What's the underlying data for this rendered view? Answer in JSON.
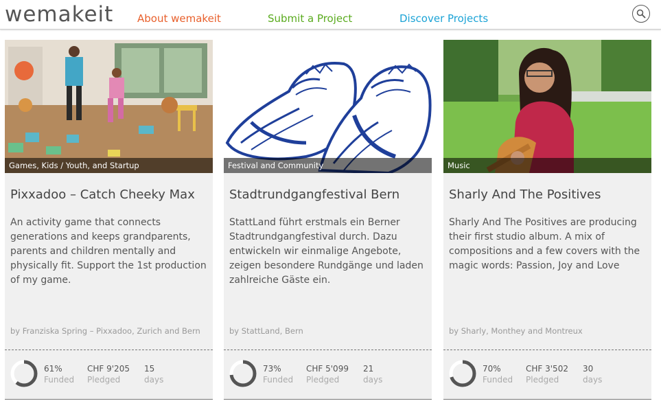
{
  "header": {
    "logo": "wemakeit",
    "nav": {
      "about": "About wemakeit",
      "submit": "Submit a Project",
      "discover": "Discover Projects"
    },
    "search_icon": "search-icon",
    "colors": {
      "about": "#e8602c",
      "submit": "#5aab1e",
      "discover": "#1ba3d6"
    }
  },
  "cards": [
    {
      "category": "Games, Kids / Youth, and Startup",
      "title": "Pixxadoo – Catch Cheeky Max",
      "description": "An activity game that connects generations and keeps grandparents, parents and children mentally and physically fit. Support the 1st production of my game.",
      "author": "by Franziska Spring – Pixxadoo, Zurich and Bern",
      "funded_value": "61%",
      "funded_label": "Funded",
      "funded_fraction": 0.61,
      "pledged_value": "CHF 9'205",
      "pledged_label": "Pledged",
      "days_value": "15",
      "days_label": "days"
    },
    {
      "category": "Festival and Community",
      "title": "Stadtrundgangfestival Bern",
      "description": "StattLand führt erstmals ein Berner Stadtrundgangfestival durch. Dazu entwickeln wir einmalige Angebote, zeigen besondere Rundgänge und laden zahlreiche Gäste ein.",
      "author": "by StattLand, Bern",
      "funded_value": "73%",
      "funded_label": "Funded",
      "funded_fraction": 0.73,
      "pledged_value": "CHF 5'099",
      "pledged_label": "Pledged",
      "days_value": "21",
      "days_label": "days"
    },
    {
      "category": "Music",
      "title": "Sharly And The Positives",
      "description": "Sharly And The Positives are producing their first studio album. A mix of compositions and a few covers with the magic words: Passion, Joy and Love",
      "author": "by Sharly, Monthey and Montreux",
      "funded_value": "70%",
      "funded_label": "Funded",
      "funded_fraction": 0.7,
      "pledged_value": "CHF 3'502",
      "pledged_label": "Pledged",
      "days_value": "30",
      "days_label": "days"
    }
  ]
}
